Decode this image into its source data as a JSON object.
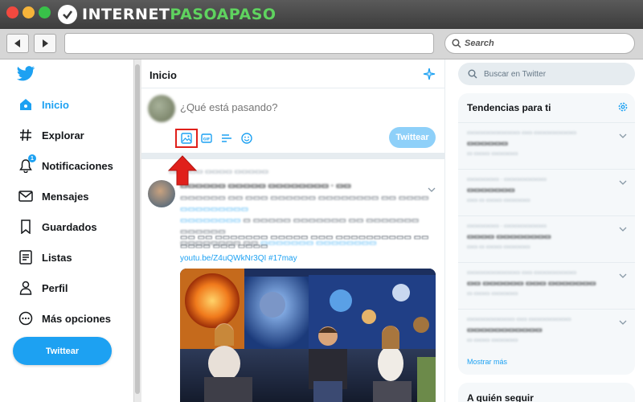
{
  "browser": {
    "brand_prefix": "INTERNET",
    "brand_accent": "PASOAPASO",
    "back_icon": "back-arrow-icon",
    "forward_icon": "forward-arrow-icon",
    "search_label": "Search"
  },
  "nav": {
    "logo_icon": "twitter-bird-icon",
    "items": [
      {
        "label": "Inicio",
        "icon": "home-icon",
        "active": true
      },
      {
        "label": "Explorar",
        "icon": "hashtag-icon"
      },
      {
        "label": "Notificaciones",
        "icon": "bell-icon",
        "badge": "1"
      },
      {
        "label": "Mensajes",
        "icon": "mail-icon"
      },
      {
        "label": "Guardados",
        "icon": "bookmark-icon"
      },
      {
        "label": "Listas",
        "icon": "list-icon"
      },
      {
        "label": "Perfil",
        "icon": "person-icon"
      },
      {
        "label": "Más opciones",
        "icon": "more-circle-icon"
      }
    ],
    "tweet_button": "Twittear"
  },
  "center": {
    "title": "Inicio",
    "composer": {
      "placeholder": "¿Qué está pasando?",
      "tools": [
        "image-icon",
        "gif-icon",
        "poll-icon",
        "emoji-icon"
      ],
      "submit": "Twittear"
    },
    "tweet": {
      "link": "youtu.be/Z4uQWkNr3QI #17may"
    }
  },
  "right": {
    "search_placeholder": "Buscar en Twitter",
    "trends_title": "Tendencias para ti",
    "show_more": "Mostrar más",
    "follow_title": "A quién seguir"
  },
  "colors": {
    "twitter_blue": "#1da1f2",
    "highlight_red": "#e0201b",
    "brand_green": "#5fd35f"
  }
}
